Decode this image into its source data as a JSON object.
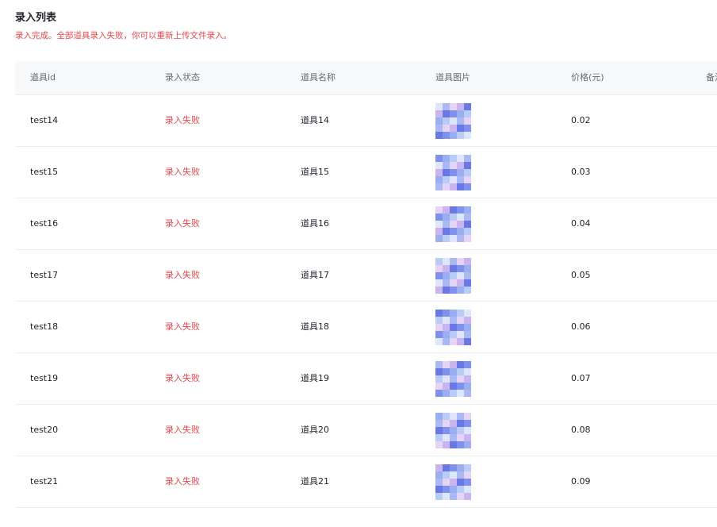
{
  "section": {
    "title": "录入列表",
    "message": "录入完成。全部道具录入失败，你可以重新上传文件录入。"
  },
  "table": {
    "columns": [
      "道具id",
      "录入状态",
      "道具名称",
      "道具图片",
      "价格(元)",
      "备注"
    ],
    "rows": [
      {
        "id": "test14",
        "status": "录入失败",
        "name": "道具14",
        "price": "0.02"
      },
      {
        "id": "test15",
        "status": "录入失败",
        "name": "道具15",
        "price": "0.03"
      },
      {
        "id": "test16",
        "status": "录入失败",
        "name": "道具16",
        "price": "0.04"
      },
      {
        "id": "test17",
        "status": "录入失败",
        "name": "道具17",
        "price": "0.05"
      },
      {
        "id": "test18",
        "status": "录入失败",
        "name": "道具18",
        "price": "0.06"
      },
      {
        "id": "test19",
        "status": "录入失败",
        "name": "道具19",
        "price": "0.07"
      },
      {
        "id": "test20",
        "status": "录入失败",
        "name": "道具20",
        "price": "0.08"
      },
      {
        "id": "test21",
        "status": "录入失败",
        "name": "道具21",
        "price": "0.09"
      }
    ]
  },
  "colors": {
    "error": "#e5484d",
    "header_bg": "#f7f8fa",
    "border": "#ebedf0",
    "thumb_palette": [
      "#dde6fb",
      "#b9cbf7",
      "#9aaef2",
      "#7f91ec",
      "#6a78e6",
      "#c9b3f0",
      "#e6d4f7",
      "#aab8f4"
    ]
  }
}
